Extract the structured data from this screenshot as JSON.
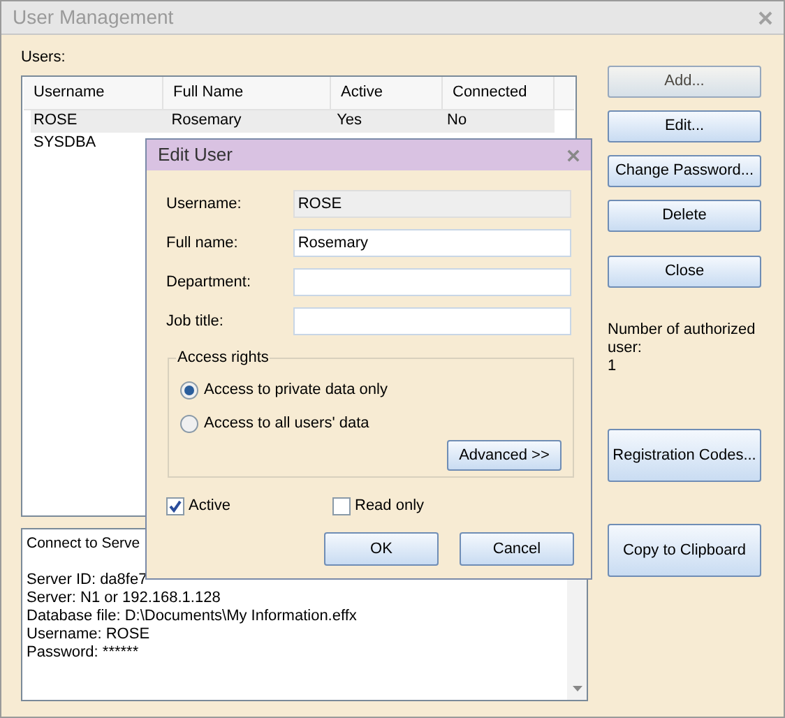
{
  "window": {
    "title": "User Management"
  },
  "users_label": "Users:",
  "table": {
    "columns": [
      "Username",
      "Full Name",
      "Active",
      "Connected"
    ],
    "rows": [
      {
        "cells": [
          "ROSE",
          "Rosemary",
          "Yes",
          "No"
        ],
        "selected": true
      },
      {
        "cells": [
          "SYSDBA"
        ],
        "selected": false
      }
    ]
  },
  "info_header": "Connect to Serve",
  "info_lines": [
    "Server ID: da8fe7",
    "Server: N1 or 192.168.1.128",
    "Database file: D:\\Documents\\My Information.effx",
    "Username: ROSE",
    "Password: ******"
  ],
  "side_buttons": [
    {
      "label": "Add...",
      "disabled": true
    },
    {
      "label": "Edit...",
      "disabled": false
    },
    {
      "label": "Change Password...",
      "disabled": false
    },
    {
      "label": "Delete",
      "disabled": false
    },
    {
      "label": "Close",
      "disabled": false
    }
  ],
  "authorized_label": "Number of authorized user:",
  "authorized_count": "1",
  "lower_buttons": [
    "Registration Codes...",
    "Copy to Clipboard"
  ],
  "dialog": {
    "title": "Edit User",
    "fields": [
      {
        "label": "Username:",
        "value": "ROSE",
        "disabled": true
      },
      {
        "label": "Full name:",
        "value": "Rosemary",
        "disabled": false
      },
      {
        "label": "Department:",
        "disabled": false
      },
      {
        "label": "Job title:",
        "disabled": false
      }
    ],
    "access_rights": {
      "title": "Access rights",
      "options": [
        {
          "label": "Access to private data only",
          "selected": true
        },
        {
          "label": "Access to all users' data",
          "selected": false
        }
      ],
      "advanced_button": "Advanced >>"
    },
    "checkboxes": [
      {
        "label": "Active",
        "checked": true
      },
      {
        "label": "Read only",
        "checked": false
      }
    ],
    "buttons": [
      "OK",
      "Cancel"
    ]
  }
}
